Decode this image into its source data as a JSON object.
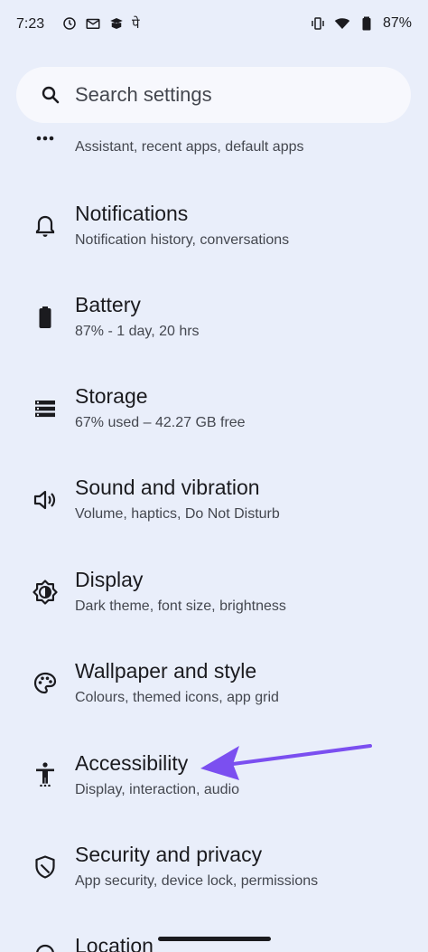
{
  "status_bar": {
    "time": "7:23",
    "battery_percent": "87%",
    "left_icons": [
      "sync-icon",
      "work-profile-icon",
      "google-pay-icon",
      "hindi-app-icon"
    ],
    "right_icons": [
      "vibrate-icon",
      "wifi-icon",
      "battery-icon"
    ],
    "hindi_glyph": "पे"
  },
  "search": {
    "placeholder": "Search settings",
    "icon": "search-icon"
  },
  "settings_items": [
    {
      "title": "",
      "subtitle": "Assistant, recent apps, default apps",
      "icon": "more-horiz-icon"
    },
    {
      "title": "Notifications",
      "subtitle": "Notification history, conversations",
      "icon": "bell-icon"
    },
    {
      "title": "Battery",
      "subtitle": "87% - 1 day, 20 hrs",
      "icon": "battery-icon"
    },
    {
      "title": "Storage",
      "subtitle": "67% used – 42.27 GB free",
      "icon": "storage-icon"
    },
    {
      "title": "Sound and vibration",
      "subtitle": "Volume, haptics, Do Not Disturb",
      "icon": "volume-icon"
    },
    {
      "title": "Display",
      "subtitle": "Dark theme, font size, brightness",
      "icon": "brightness-icon"
    },
    {
      "title": "Wallpaper and style",
      "subtitle": "Colours, themed icons, app grid",
      "icon": "palette-icon"
    },
    {
      "title": "Accessibility",
      "subtitle": "Display, interaction, audio",
      "icon": "accessibility-icon"
    },
    {
      "title": "Security and privacy",
      "subtitle": "App security, device lock, permissions",
      "icon": "shield-icon"
    },
    {
      "title": "Location",
      "subtitle": "",
      "icon": "location-icon"
    }
  ],
  "annotation": {
    "color": "#7b4ff0",
    "target": "Accessibility"
  },
  "colors": {
    "background": "#e9eefa",
    "search_bg": "#f7f8fd",
    "text_primary": "#1b1b1f",
    "text_secondary": "#44474f"
  }
}
